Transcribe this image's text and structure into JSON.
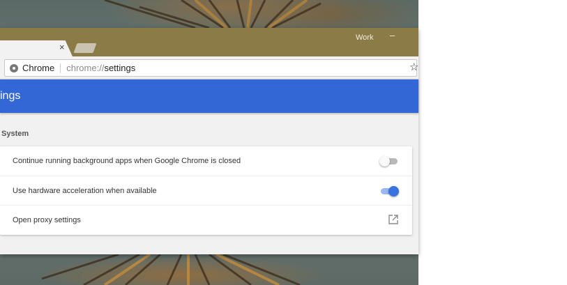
{
  "window": {
    "profile_name": "Work",
    "minimize_glyph": "–",
    "tab": {
      "close_glyph": "×"
    },
    "omnibox": {
      "site_label": "Chrome",
      "url_scheme": "chrome://",
      "url_path": "settings",
      "bookmark_glyph": "☆"
    }
  },
  "settings": {
    "header_title": "ings",
    "section_title": "System",
    "rows": [
      {
        "label": "Continue running background apps when Google Chrome is closed",
        "control": "toggle",
        "enabled": false
      },
      {
        "label": "Use hardware acceleration when available",
        "control": "toggle",
        "enabled": true
      },
      {
        "label": "Open proxy settings",
        "control": "external-link-icon"
      }
    ]
  },
  "colors": {
    "titlebar": "#8a7b47",
    "header": "#3367d6",
    "toggle_on": "#3a73e0"
  }
}
